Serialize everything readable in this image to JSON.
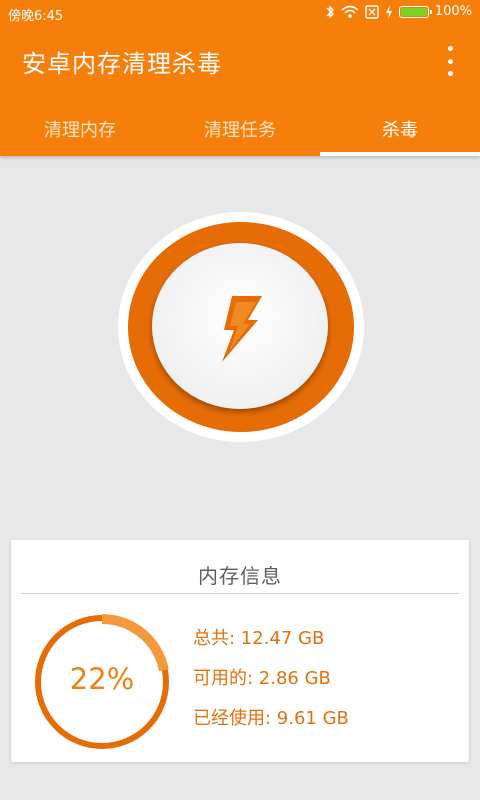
{
  "status_bar": {
    "time": "傍晚6:45",
    "battery_percent": "100%",
    "icons": [
      "bluetooth-icon",
      "wifi-icon",
      "sim-icon",
      "charging-icon",
      "battery-icon"
    ]
  },
  "app_bar": {
    "title": "安卓内存清理杀毒",
    "menu_icon": "more-vert-icon"
  },
  "tabs": [
    {
      "label": "清理内存",
      "active": false
    },
    {
      "label": "清理任务",
      "active": false
    },
    {
      "label": "杀毒",
      "active": true
    }
  ],
  "main_button": {
    "icon": "lightning-bolt-icon"
  },
  "memory_card": {
    "title": "内存信息",
    "usage_percent_label": "22%",
    "usage_fraction": 0.22,
    "total": "总共: 12.47 GB",
    "available": "可用的: 2.86 GB",
    "used": "已经使用: 9.61 GB"
  },
  "colors": {
    "primary": "#f67f0c",
    "ring": "#e66c06",
    "accent_text": "#e3710d",
    "background": "#e8e8e8"
  }
}
